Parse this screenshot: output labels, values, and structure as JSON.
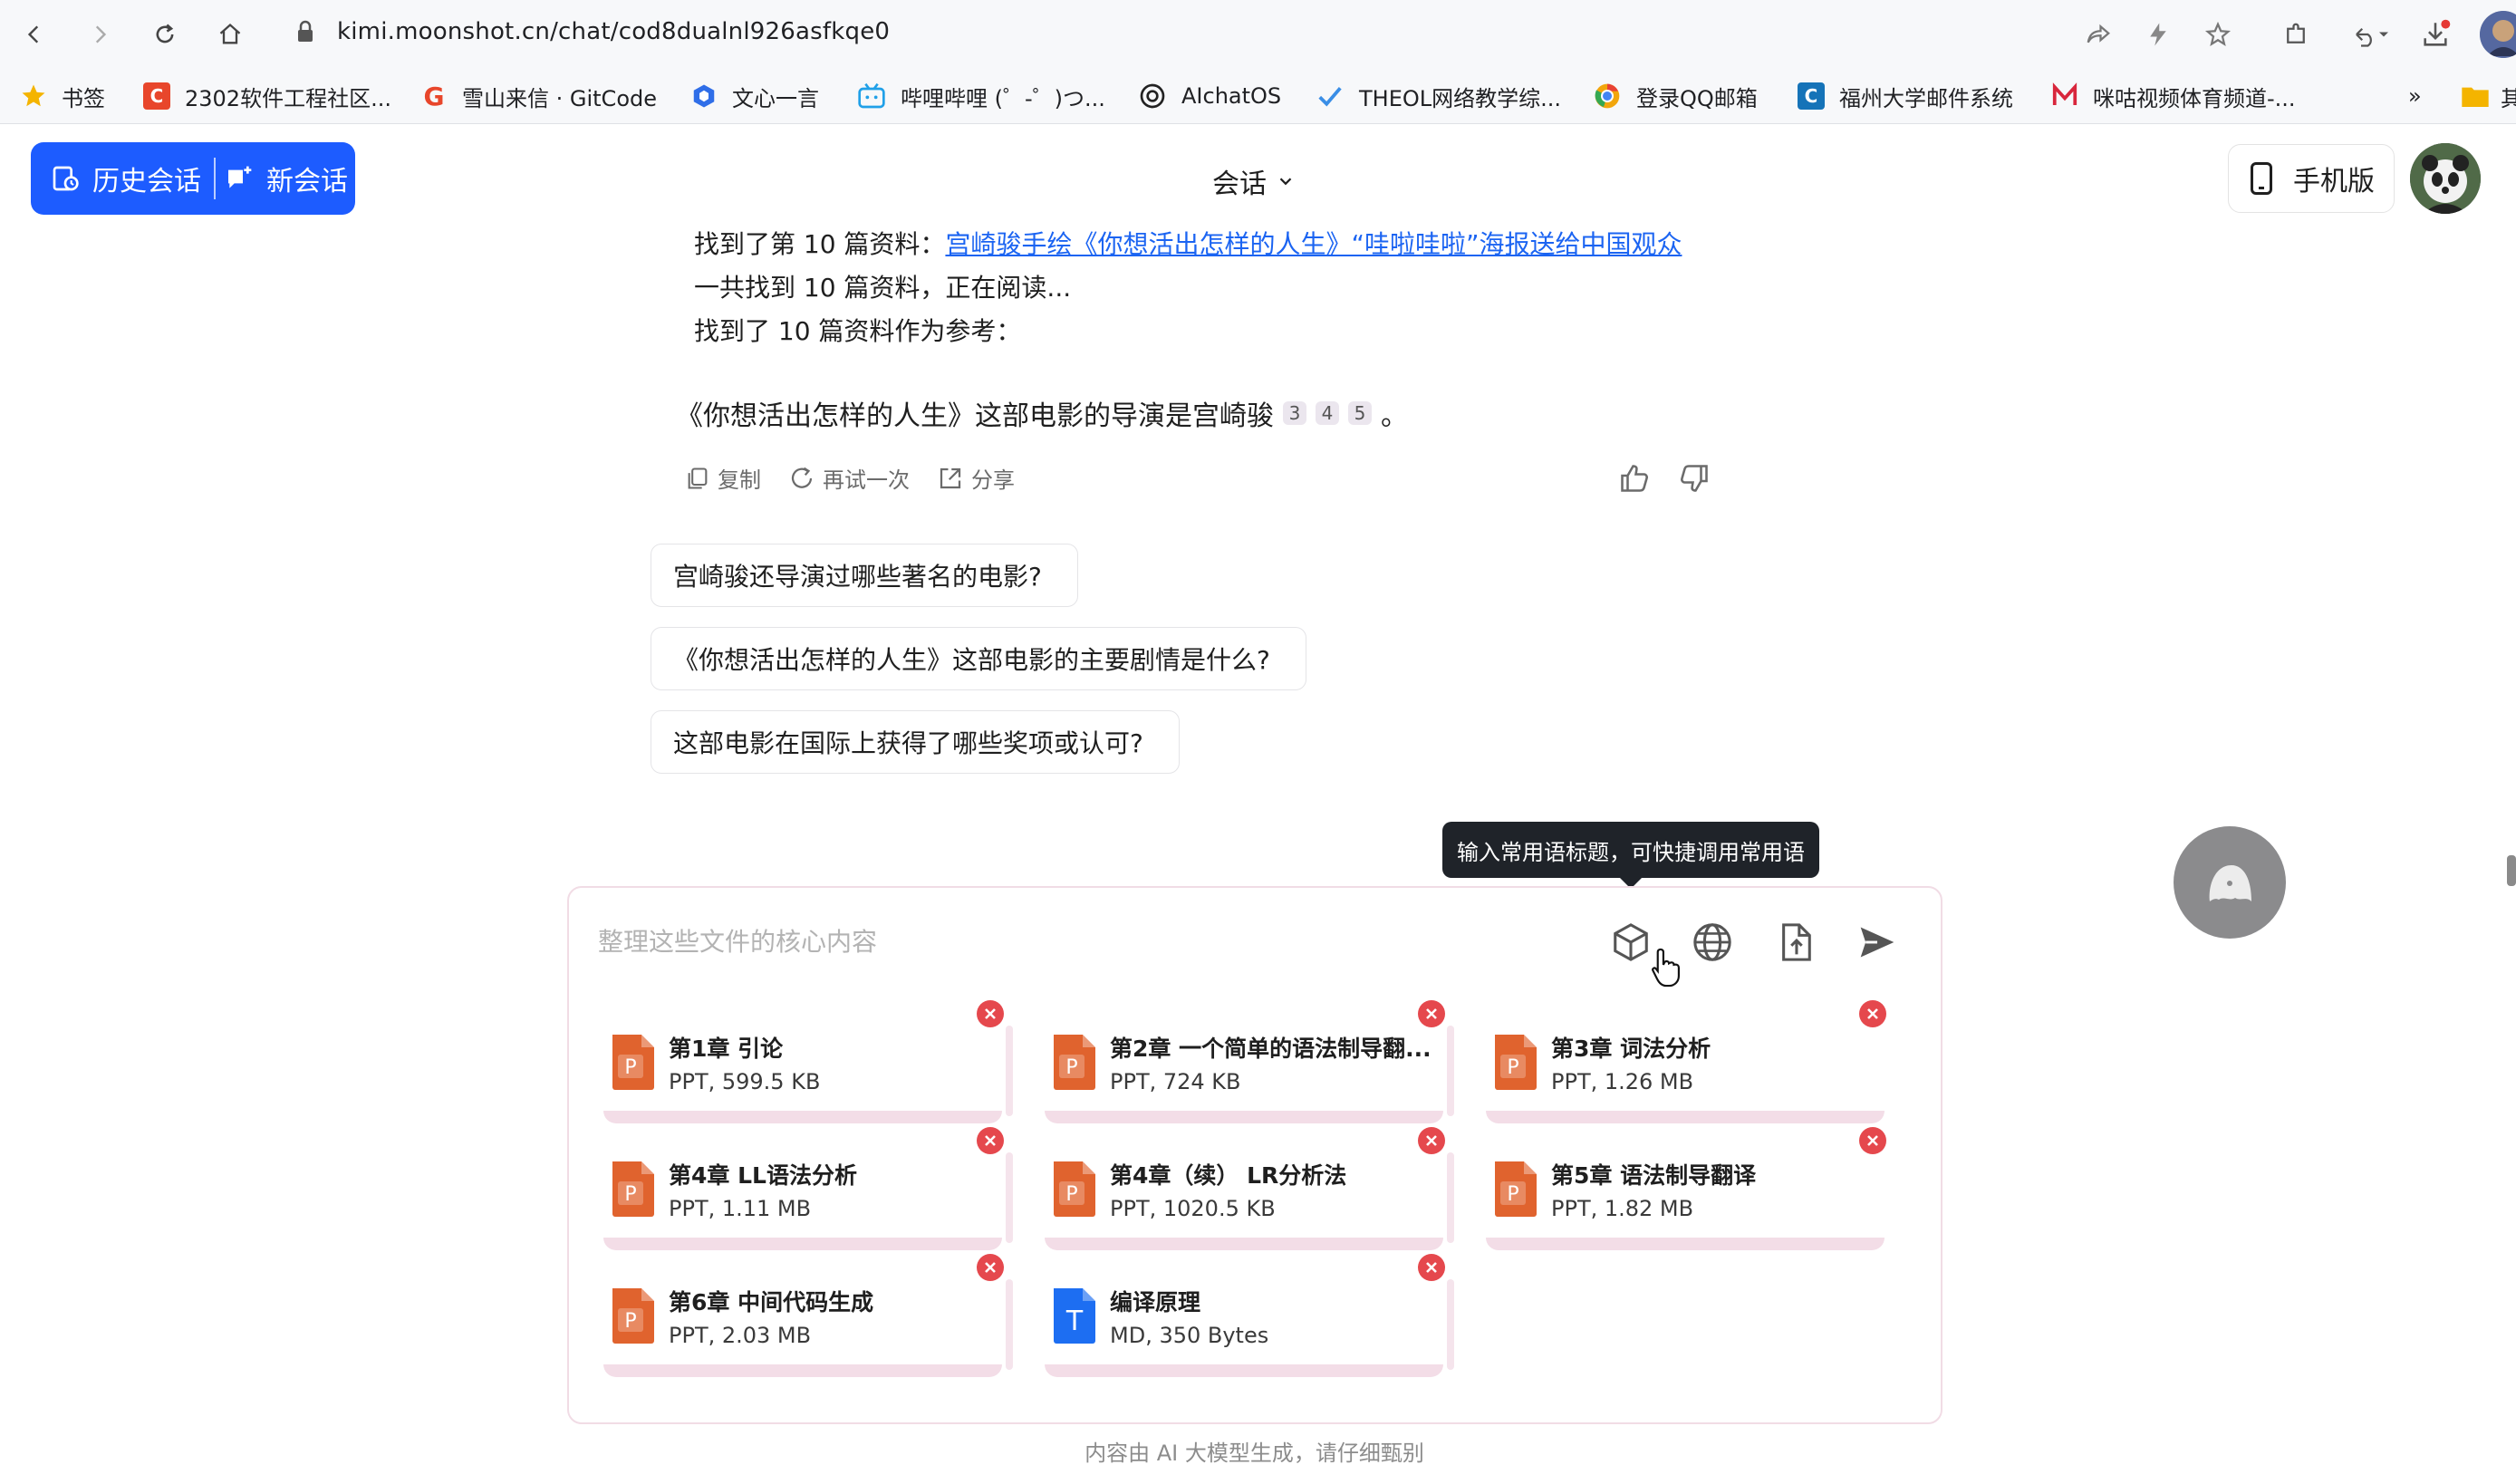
{
  "browser": {
    "url": "kimi.moonshot.cn/chat/cod8dualnl926asfkqe0",
    "bookmarks": [
      {
        "label": "书签",
        "icon": "star-icon",
        "color": "#f4b400"
      },
      {
        "label": "2302软件工程社区...",
        "icon": "csdn-c-icon",
        "color": "#e8462b"
      },
      {
        "label": "雪山来信 · GitCode",
        "icon": "gitcode-g-icon",
        "color": "#e8462b"
      },
      {
        "label": "文心一言",
        "icon": "wenxin-cube-icon",
        "color": "#2f6ee8"
      },
      {
        "label": "哔哩哔哩 (゜-゜)つ...",
        "icon": "bilibili-tv-icon",
        "color": "#20a0e8"
      },
      {
        "label": "AIchatOS",
        "icon": "openai-knot-icon",
        "color": "#222222"
      },
      {
        "label": "THEOL网络教学综...",
        "icon": "theol-check-icon",
        "color": "#3a8ee6"
      },
      {
        "label": "登录QQ邮箱",
        "icon": "chrome-ring-icon",
        "color": "#f2a60c"
      },
      {
        "label": "福州大学邮件系统",
        "icon": "fzu-c-icon",
        "color": "#1573b8"
      },
      {
        "label": "咪咕视频体育频道-...",
        "icon": "migu-m-icon",
        "color": "#d8263c"
      }
    ],
    "bookmarks_more": "»",
    "folder_label": "其"
  },
  "header": {
    "history_label": "历史会话",
    "new_label": "新会话",
    "conversation_title": "会话",
    "mobile_label": "手机版",
    "accent": "#1d5cff"
  },
  "chat": {
    "found_10_prefix": "找到了第 10 篇资料：",
    "found_10_link": "宫崎骏手绘《你想活出怎样的人生》“哇啦哇啦”海报送给中国观众",
    "found_total": "一共找到 10 篇资料，正在阅读...",
    "found_ref": "找到了 10 篇资料作为参考：",
    "answer_text": "《你想活出怎样的人生》这部电影的导演是宫崎骏",
    "answer_refs": [
      "3",
      "4",
      "5"
    ],
    "answer_end": "。",
    "actions": {
      "copy": "复制",
      "retry": "再试一次",
      "share": "分享"
    },
    "suggestions": [
      "宫崎骏还导演过哪些著名的电影?",
      "《你想活出怎样的人生》这部电影的主要剧情是什么?",
      "这部电影在国际上获得了哪些奖项或认可?"
    ]
  },
  "tooltip": "输入常用语标题，可快捷调用常用语",
  "input": {
    "placeholder": "整理这些文件的核心内容",
    "files": [
      {
        "name": "第1章 引论",
        "meta": "PPT, 599.5 KB",
        "type": "ppt"
      },
      {
        "name": "第2章 一个简单的语法制导翻...",
        "meta": "PPT, 724 KB",
        "type": "ppt"
      },
      {
        "name": "第3章 词法分析",
        "meta": "PPT, 1.26 MB",
        "type": "ppt"
      },
      {
        "name": "第4章 LL语法分析",
        "meta": "PPT, 1.11 MB",
        "type": "ppt"
      },
      {
        "name": "第4章（续） LR分析法",
        "meta": "PPT, 1020.5 KB",
        "type": "ppt"
      },
      {
        "name": "第5章 语法制导翻译",
        "meta": "PPT, 1.82 MB",
        "type": "ppt"
      },
      {
        "name": "第6章 中间代码生成",
        "meta": "PPT, 2.03 MB",
        "type": "ppt"
      },
      {
        "name": "编译原理",
        "meta": "MD, 350 Bytes",
        "type": "md"
      }
    ],
    "ppt_letter": "P",
    "md_letter": "T",
    "ppt_color": "#e0632e",
    "md_color": "#1d6ef2"
  },
  "footer_note": "内容由 AI 大模型生成，请仔细甄别"
}
